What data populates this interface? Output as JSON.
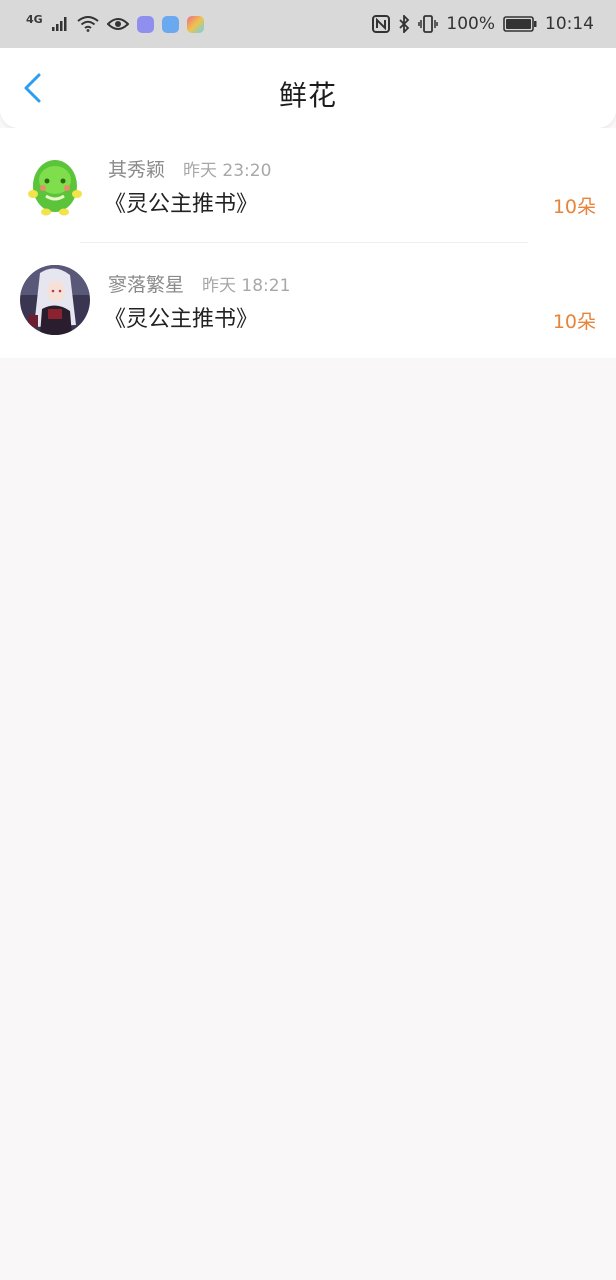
{
  "status_bar": {
    "network": "4G",
    "battery": "100%",
    "time": "10:14"
  },
  "header": {
    "title": "鲜花"
  },
  "items": [
    {
      "name": "其秀颖",
      "time": "昨天 23:20",
      "book": "《灵公主推书》",
      "count": "10朵"
    },
    {
      "name": "寥落繁星",
      "time": "昨天 18:21",
      "book": "《灵公主推书》",
      "count": "10朵"
    }
  ],
  "colors": {
    "accent_blue": "#2a9df4",
    "count_orange": "#e8833a"
  }
}
